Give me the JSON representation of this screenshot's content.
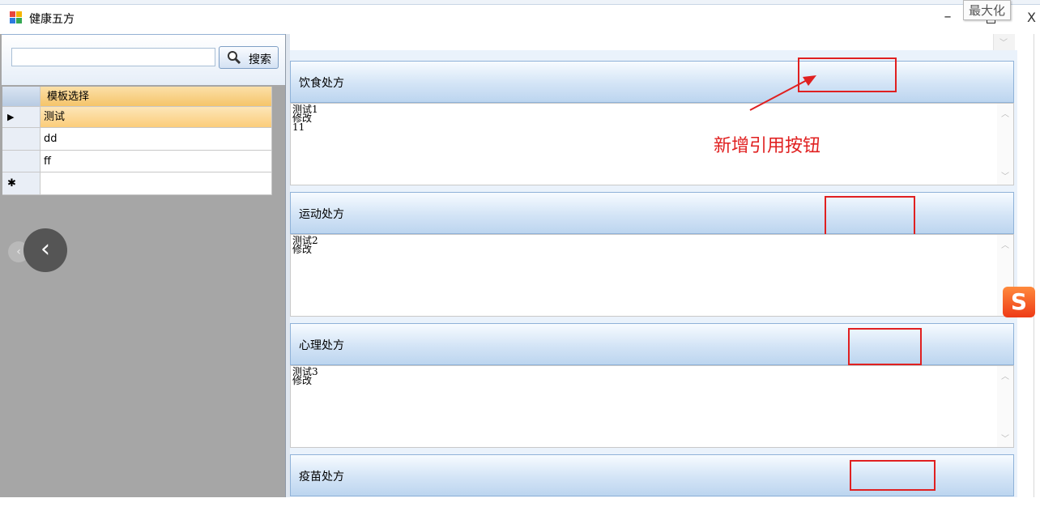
{
  "window": {
    "title": "健康五方",
    "tooltip": "最大化",
    "minimize_glyph": "–",
    "close_glyph": "X"
  },
  "search": {
    "button_label": "搜索",
    "input_value": ""
  },
  "grid": {
    "column_header": "模板选择",
    "rows": [
      {
        "marker": "▶",
        "value": "测试",
        "selected": true
      },
      {
        "marker": "",
        "value": "dd",
        "selected": false
      },
      {
        "marker": "",
        "value": "ff",
        "selected": false
      },
      {
        "marker": "✱",
        "value": "",
        "selected": false
      }
    ]
  },
  "carousel": {
    "prev_glyph": "‹"
  },
  "sections": [
    {
      "title": "饮食处方",
      "content": "测试1\n修改\n11"
    },
    {
      "title": "运动处方",
      "content": "测试2\n修改"
    },
    {
      "title": "心理处方",
      "content": "测试3\n修改"
    },
    {
      "title": "疫苗处方",
      "content": ""
    }
  ],
  "annotation": {
    "text": "新增引用按钮",
    "color": "#e02020"
  },
  "ime_badge": "S",
  "colors": {
    "accent_blue": "#bcd5ef",
    "selected_row": "#fbcd7a",
    "left_panel": "#a6a6a6",
    "red_box": "#e02020"
  }
}
